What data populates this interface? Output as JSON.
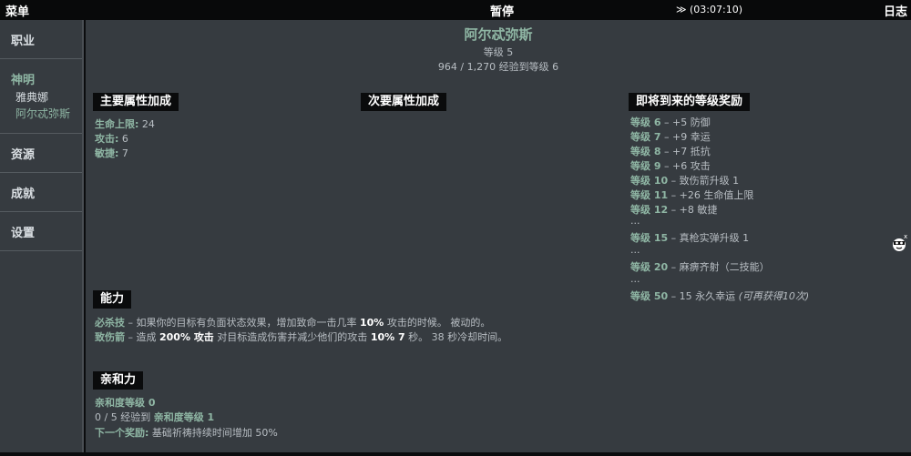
{
  "topbar": {
    "menu": "菜单",
    "pause": "暂停",
    "timer": "≫ (03:07:10)",
    "log": "日志"
  },
  "sidebar": {
    "career": "职业",
    "gods": "神明",
    "god_items": [
      "雅典娜",
      "阿尔忒弥斯"
    ],
    "resources": "资源",
    "achievements": "成就",
    "settings": "设置"
  },
  "header": {
    "name": "阿尔忒弥斯",
    "level": "等级 5",
    "xp": "964 / 1,270 经验到等级 6"
  },
  "primary": {
    "title": "主要属性加成",
    "stats": [
      {
        "label": "生命上限:",
        "value": "24"
      },
      {
        "label": "攻击:",
        "value": "6"
      },
      {
        "label": "敏捷:",
        "value": "7"
      }
    ]
  },
  "secondary": {
    "title": "次要属性加成"
  },
  "rewards": {
    "title": "即将到来的等级奖励",
    "items": [
      {
        "level": "等级 6",
        "text": " – +5 防御"
      },
      {
        "level": "等级 7",
        "text": " – +9 幸运"
      },
      {
        "level": "等级 8",
        "text": " – +7 抵抗"
      },
      {
        "level": "等级 9",
        "text": " – +6 攻击"
      },
      {
        "level": "等级 10",
        "text": " – 致伤箭升级 1"
      },
      {
        "level": "等级 11",
        "text": " – +26 生命值上限"
      },
      {
        "level": "等级 12",
        "text": " – +8 敏捷"
      },
      {
        "level": "等级 15",
        "text": " – 真枪实弹升级 1"
      },
      {
        "level": "等级 20",
        "text": " – 麻痹齐射（二技能）"
      },
      {
        "level": "等级 50",
        "text": " – 15 永久幸运 ",
        "note": "(可再获得10次)"
      }
    ],
    "ellipsis": "..."
  },
  "abilities": {
    "title": "能力",
    "a1": {
      "name": "必杀技",
      "t1": " – 如果你的目标有负面状态效果，增加致命一击几率 ",
      "v1": "10%",
      "t2": " 攻击的时候。 被动的。"
    },
    "a2": {
      "name": "致伤箭",
      "t1": " – 造成 ",
      "v1": "200% 攻击",
      "t2": " 对目标造成伤害并减少他们的攻击 ",
      "v2": "10% 7",
      "t3": " 秒。 38 秒冷却时间。"
    }
  },
  "affinity": {
    "title": "亲和力",
    "level": "亲和度等级 0",
    "progress_pre": "0 / 5 经验到 ",
    "progress_target": "亲和度等级 1",
    "next_label": "下一个奖励:",
    "next_text": " 基础祈祷持续时间增加 50%"
  },
  "colors": {
    "accent": "#8fb6a4",
    "panel": "#363b40",
    "header_bg": "#0a0b0c"
  },
  "icons": {
    "mascot": "masked-face-icon"
  }
}
